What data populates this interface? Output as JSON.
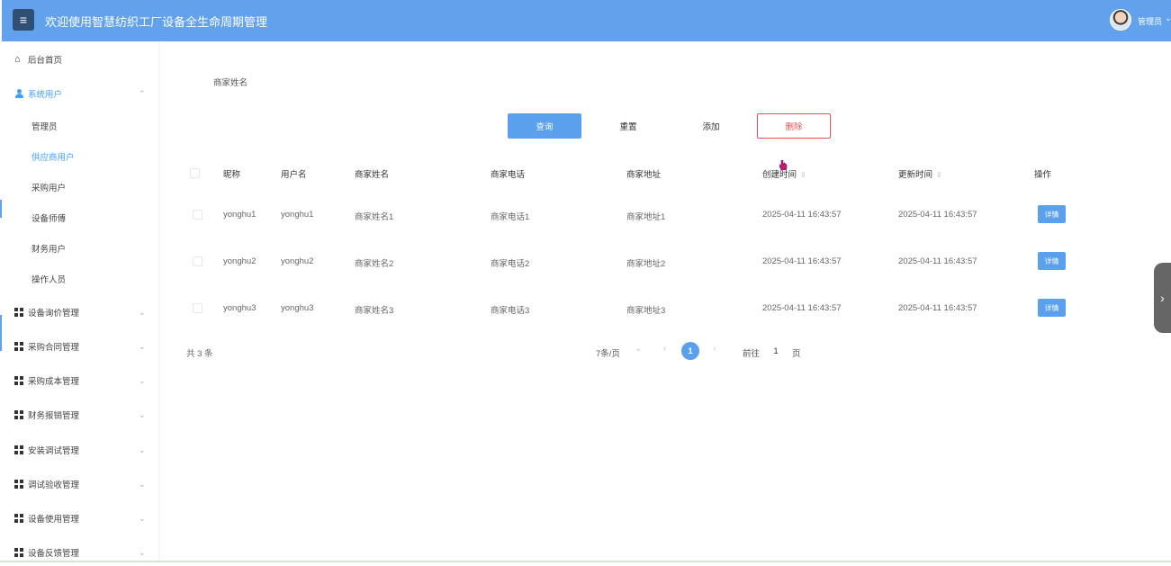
{
  "header": {
    "title": "欢迎使用智慧纺织工厂设备全生命周期管理",
    "user": "管理员",
    "colors": {
      "bar": "#62a2ec",
      "menu_button": "#2f4f74"
    }
  },
  "sidebar": {
    "home": "后台首页",
    "system_users": {
      "label": "系统用户",
      "children": [
        "管理员",
        "供应商用户",
        "采购用户",
        "设备师傅",
        "财务用户",
        "操作人员"
      ],
      "active": "供应商用户"
    },
    "menus": [
      "设备询价管理",
      "采购合同管理",
      "采购成本管理",
      "财务报销管理",
      "安装调试管理",
      "调试验收管理",
      "设备使用管理",
      "设备反馈管理"
    ]
  },
  "filter": {
    "label": "商家姓名"
  },
  "buttons": {
    "query": "查询",
    "reset": "重置",
    "add": "添加",
    "delete": "删除"
  },
  "table": {
    "headers": [
      "昵称",
      "用户名",
      "商家姓名",
      "商家电话",
      "商家地址",
      "创建时间",
      "更新时间",
      "操作"
    ],
    "sort_icon": "⇕",
    "rows": [
      {
        "nickname": "yonghu1",
        "username": "yonghu1",
        "merchant_name": "商家姓名1",
        "phone": "商家电话1",
        "address": "商家地址1",
        "created": "2025-04-11 16:43:57",
        "updated": "2025-04-11 16:43:57",
        "action": "详情"
      },
      {
        "nickname": "yonghu2",
        "username": "yonghu2",
        "merchant_name": "商家姓名2",
        "phone": "商家电话2",
        "address": "商家地址2",
        "created": "2025-04-11 16:43:57",
        "updated": "2025-04-11 16:43:57",
        "action": "详情"
      },
      {
        "nickname": "yonghu3",
        "username": "yonghu3",
        "merchant_name": "商家姓名3",
        "phone": "商家电话3",
        "address": "商家地址3",
        "created": "2025-04-11 16:43:57",
        "updated": "2025-04-11 16:43:57",
        "action": "详情"
      }
    ]
  },
  "pagination": {
    "total": "共 3 条",
    "page_size": "7条/页",
    "current_page": "1",
    "goto_label": "前往",
    "goto_value": "1",
    "goto_unit": "页"
  },
  "accent_color": "#5aa0ec",
  "danger_color": "#e05353"
}
